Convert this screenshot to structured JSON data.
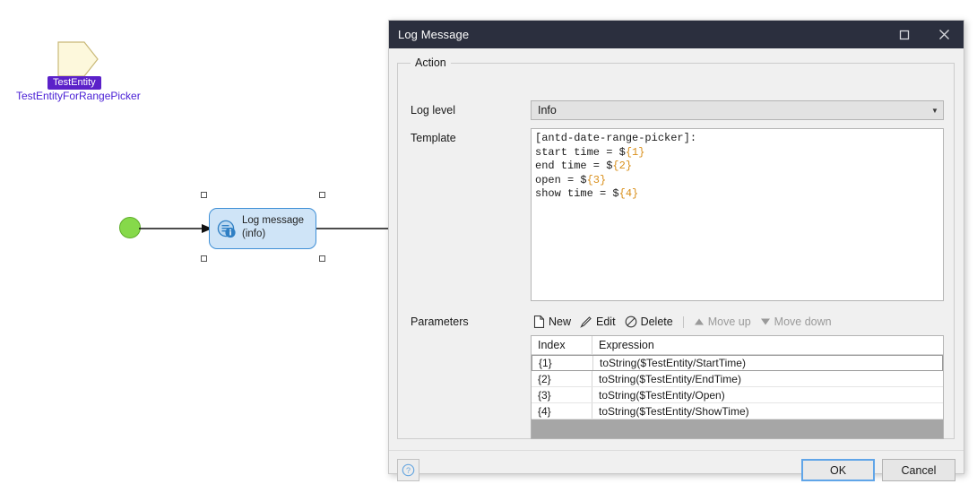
{
  "canvas": {
    "entity": {
      "shape_name": "entity-pentagon",
      "badge_label": "TestEntity",
      "badge_color": "#5b21c9",
      "sub_label": "TestEntityForRangePicker",
      "sub_label_color": "#4b21d6"
    },
    "start_node": {
      "name": "start-event",
      "color": "#86d94a"
    },
    "activity_node": {
      "icon": "log-message-info-icon",
      "title": "Log message",
      "subtitle": "(info)",
      "fill": "#cfe4f7",
      "border": "#3f8fd6",
      "selected": true
    }
  },
  "dialog": {
    "title": "Log Message",
    "titlebar_bg": "#2b2f3e",
    "window_buttons": {
      "maximize": "maximize-icon",
      "close": "close-icon"
    },
    "group": {
      "title": "Action"
    },
    "log_level": {
      "label": "Log level",
      "value": "Info",
      "arrow": "chevron-down-icon"
    },
    "template": {
      "label": "Template",
      "lines": [
        {
          "text": "[antd-date-range-picker]:",
          "placeholder": ""
        },
        {
          "text": "start time = $",
          "placeholder": "{1}"
        },
        {
          "text": "end time = $",
          "placeholder": "{2}"
        },
        {
          "text": "open = $",
          "placeholder": "{3}"
        },
        {
          "text": "show time = $",
          "placeholder": "{4}"
        }
      ],
      "placeholder_color": "#d98f1a"
    },
    "parameters": {
      "label": "Parameters",
      "toolbar": [
        {
          "label": "New",
          "icon": "new-document-icon",
          "disabled": false
        },
        {
          "label": "Edit",
          "icon": "pencil-icon",
          "disabled": false
        },
        {
          "label": "Delete",
          "icon": "no-entry-icon",
          "disabled": false
        },
        {
          "label": "Move up",
          "icon": "triangle-up-icon",
          "disabled": true
        },
        {
          "label": "Move down",
          "icon": "triangle-down-icon",
          "disabled": true
        }
      ],
      "columns": [
        "Index",
        "Expression"
      ],
      "rows": [
        {
          "index": "{1}",
          "expression": "toString($TestEntity/StartTime)",
          "selected": true
        },
        {
          "index": "{2}",
          "expression": "toString($TestEntity/EndTime)",
          "selected": false
        },
        {
          "index": "{3}",
          "expression": "toString($TestEntity/Open)",
          "selected": false
        },
        {
          "index": "{4}",
          "expression": "toString($TestEntity/ShowTime)",
          "selected": false
        }
      ]
    },
    "footer": {
      "help_icon": "help-question-icon",
      "ok_label": "OK",
      "cancel_label": "Cancel",
      "focus_color": "#60a5e8"
    }
  }
}
